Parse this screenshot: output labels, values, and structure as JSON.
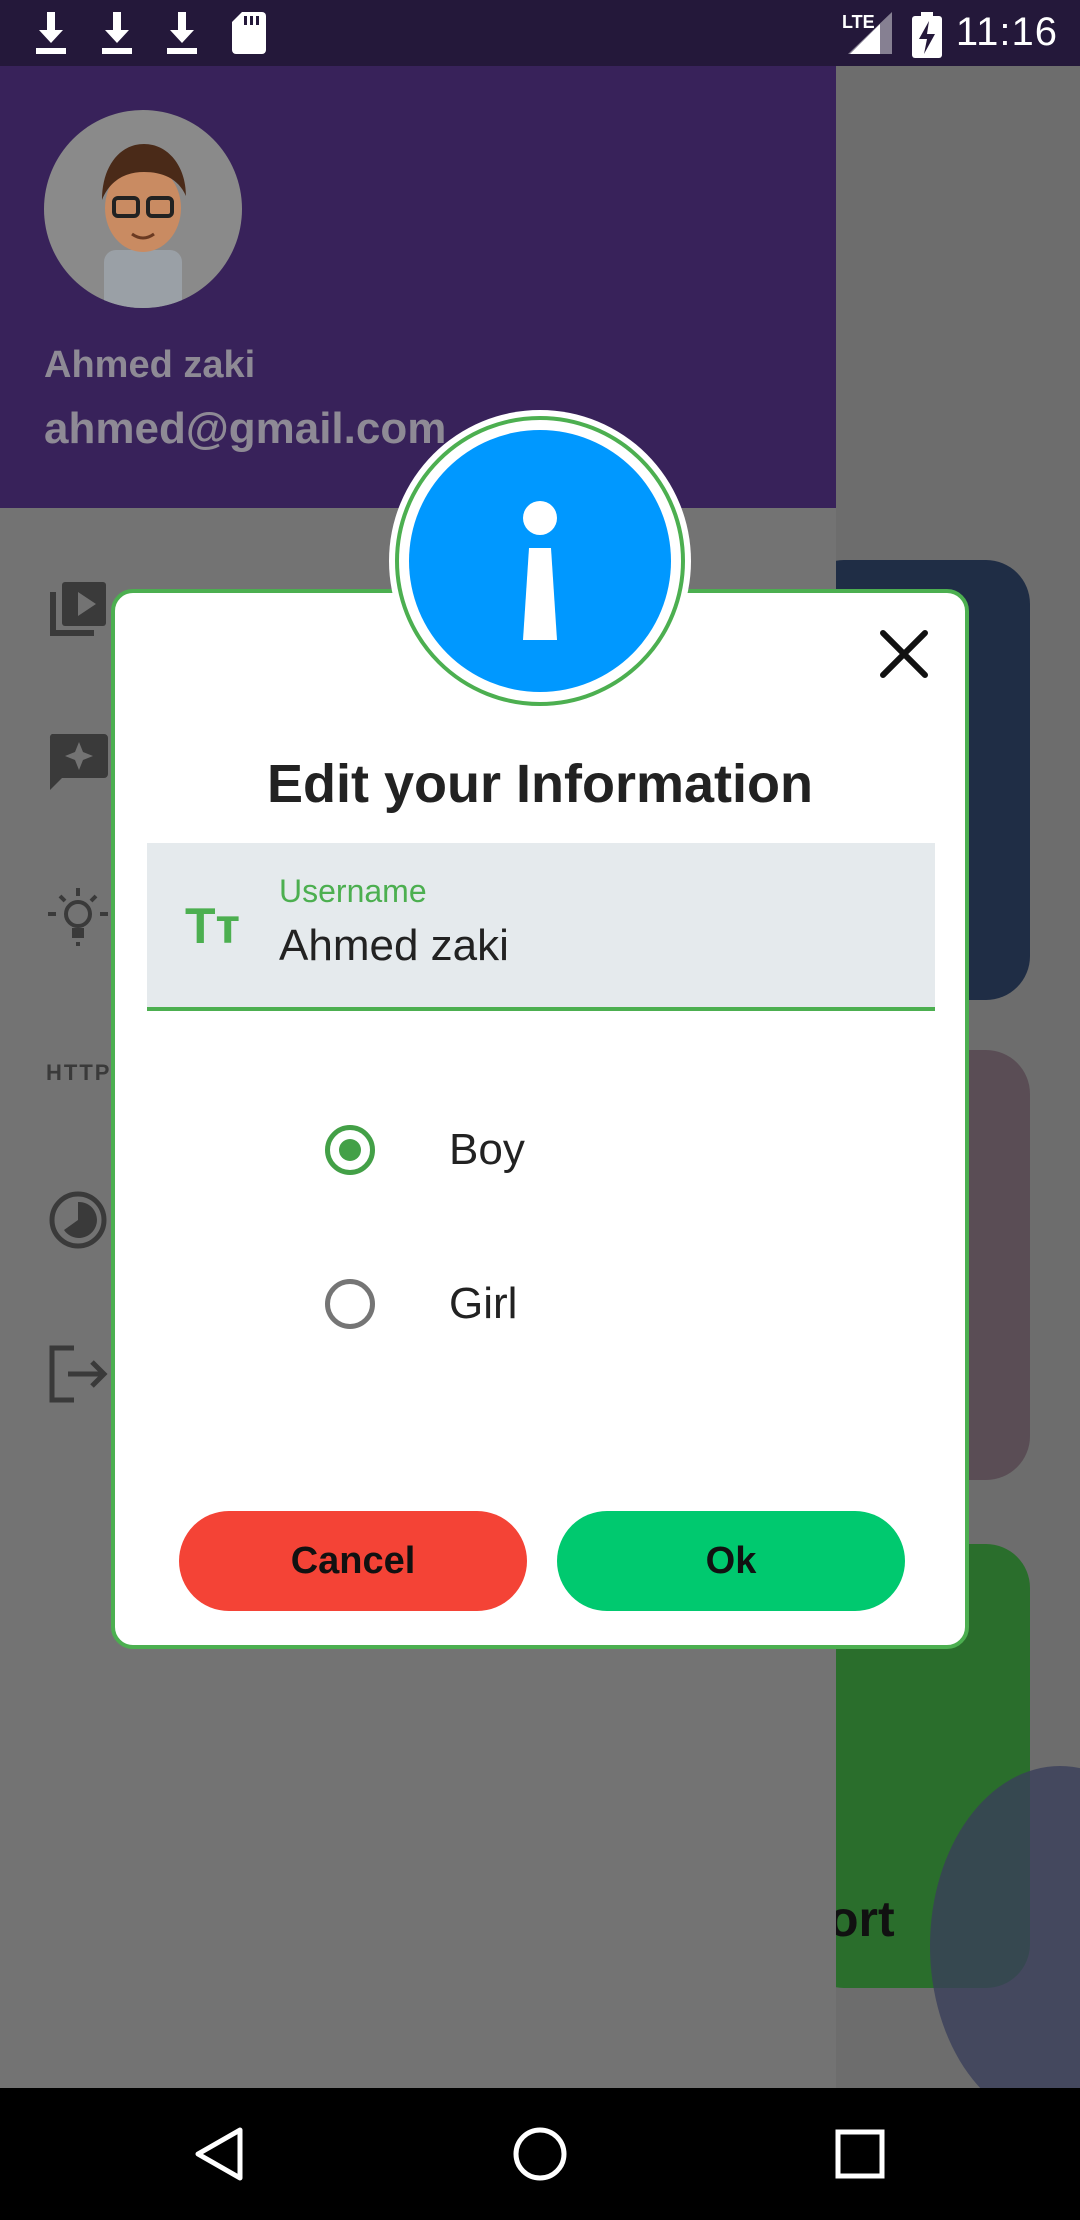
{
  "status_bar": {
    "time": "11:16",
    "network_label": "LTE",
    "icons": [
      "download-icon",
      "download-icon",
      "download-icon",
      "sd-card-icon",
      "signal-icon",
      "battery-charging-icon"
    ]
  },
  "drawer": {
    "user_name": "Ahmed zaki",
    "user_email": "ahmed@gmail.com",
    "section_label": "HTTP",
    "menu_icons": [
      "video-library-icon",
      "feedback-icon",
      "lightbulb-icon",
      "history-icon",
      "logout-icon"
    ]
  },
  "background_card": {
    "partial_text": "ort"
  },
  "dialog": {
    "title": "Edit your Information",
    "username_field": {
      "label": "Username",
      "value": "Ahmed zaki",
      "icon_glyph": "Tт"
    },
    "gender_options": [
      {
        "label": "Boy",
        "checked": true
      },
      {
        "label": "Girl",
        "checked": false
      }
    ],
    "cancel_label": "Cancel",
    "ok_label": "Ok"
  },
  "colors": {
    "accent_green": "#4caf50",
    "info_blue": "#0098ff",
    "cancel_red": "#f44336",
    "ok_green": "#00c96f",
    "drawer_header": "#38225a"
  }
}
